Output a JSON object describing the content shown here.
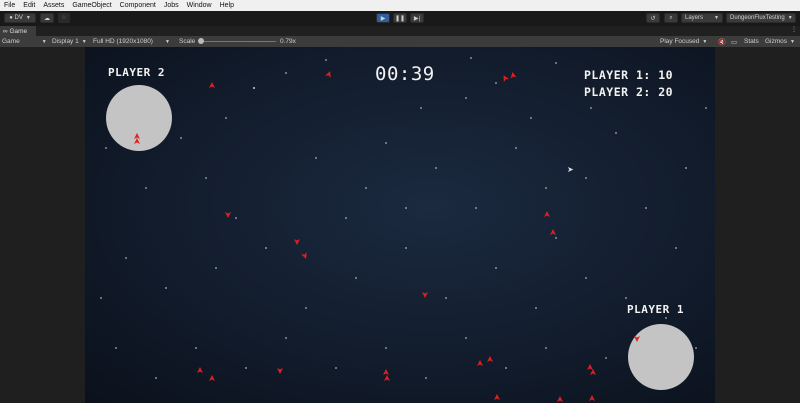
{
  "menu": [
    "File",
    "Edit",
    "Assets",
    "GameObject",
    "Component",
    "Jobs",
    "Window",
    "Help"
  ],
  "toolbar": {
    "account_label": "DV",
    "layers_label": "Layers",
    "layout_label": "DungeonFluxTesting"
  },
  "tabs": {
    "game_tab": "Game"
  },
  "game_toolbar": {
    "view_mode": "Game",
    "display": "Display 1",
    "resolution": "Full HD (1920x1080)",
    "scale_label": "Scale",
    "scale_value": "0.79x",
    "play_mode": "Play Focused",
    "stats_label": "Stats",
    "gizmos_label": "Gizmos"
  },
  "hud": {
    "timer": "00:39",
    "left_player_label": "PLAYER 2",
    "right_player_label": "PLAYER 1",
    "scores": [
      {
        "label": "PLAYER 1:",
        "value": "10"
      },
      {
        "label": "PLAYER 2:",
        "value": "20"
      }
    ]
  },
  "colors": {
    "space_background": "#121c2c",
    "planet": "#c4c4c4",
    "ship": "#e02020",
    "play_button": "#2f5f9e"
  }
}
